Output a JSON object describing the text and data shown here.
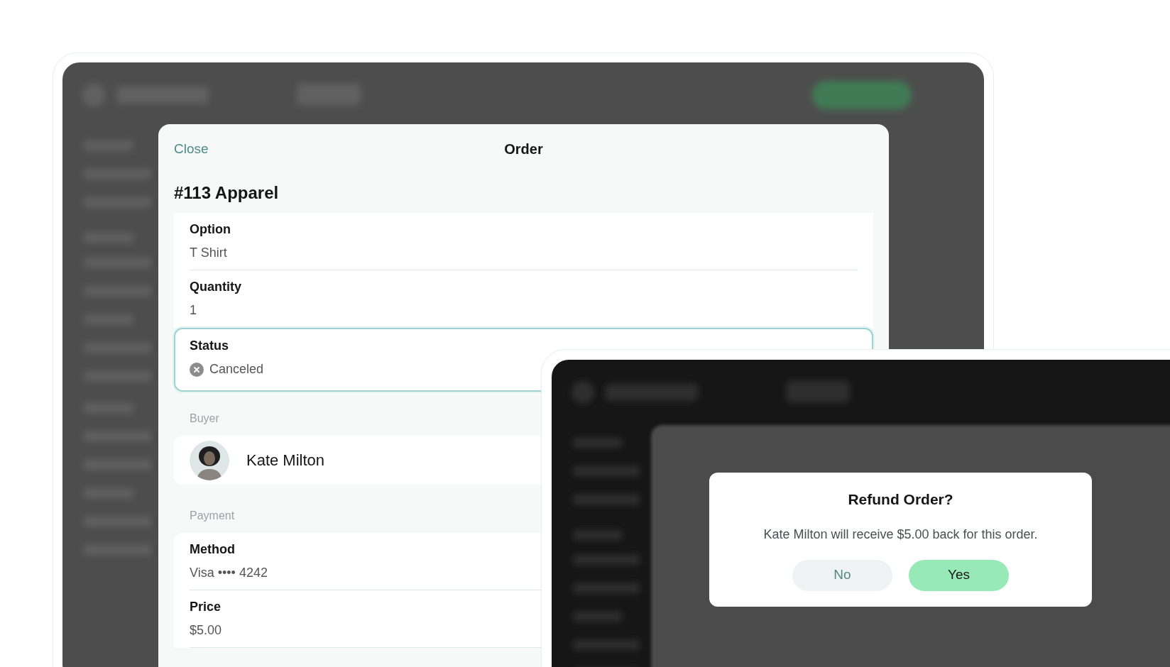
{
  "order_sheet": {
    "close": "Close",
    "title": "Order",
    "heading": "#113 Apparel",
    "item_fields": [
      {
        "label": "Option",
        "value": "T Shirt",
        "focused": false,
        "kind": "text"
      },
      {
        "label": "Quantity",
        "value": "1",
        "focused": false,
        "kind": "text"
      },
      {
        "label": "Status",
        "value": "Canceled",
        "focused": true,
        "kind": "status"
      }
    ],
    "buyer": {
      "section": "Buyer",
      "name": "Kate Milton"
    },
    "payment": {
      "section": "Payment",
      "fields": [
        {
          "label": "Method",
          "value": "Visa •••• 4242"
        },
        {
          "label": "Price",
          "value": "$5.00"
        }
      ]
    }
  },
  "refund_dialog": {
    "title": "Refund Order?",
    "message": "Kate Milton will receive $5.00 back for this order.",
    "buttons": [
      {
        "label": "No",
        "primary": false
      },
      {
        "label": "Yes",
        "primary": true
      }
    ]
  }
}
